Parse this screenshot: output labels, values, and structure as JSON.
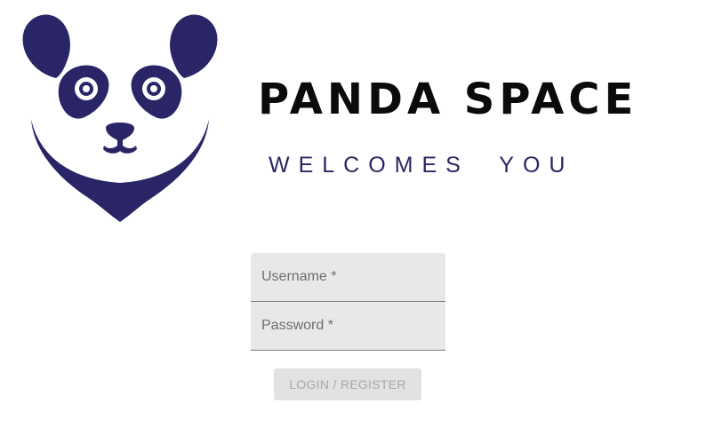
{
  "brand": {
    "title": "PANDA SPACE",
    "tagline": "WELCOMES  YOU",
    "logo_icon": "panda-face-icon",
    "logo_color": "#2a2566"
  },
  "login_form": {
    "username_placeholder": "Username *",
    "password_placeholder": "Password *",
    "submit_label": "LOGIN / REGISTER",
    "field_background": "#e8e8e8",
    "button_background": "#e2e2e2"
  }
}
